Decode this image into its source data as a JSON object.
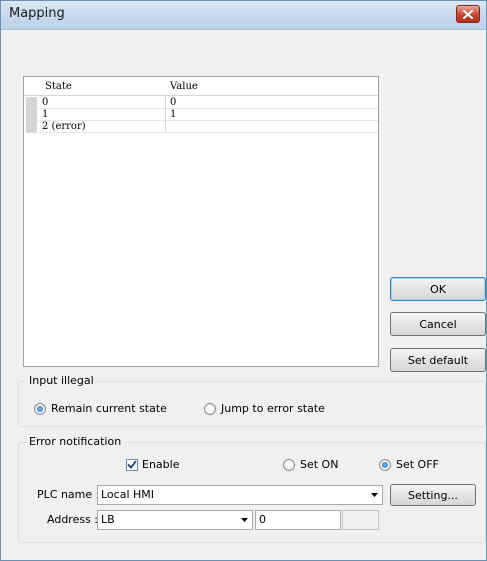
{
  "window": {
    "title": "Mapping"
  },
  "grid": {
    "columns": [
      "State",
      "Value"
    ],
    "rows": [
      {
        "state": "0",
        "value": "0"
      },
      {
        "state": "1",
        "value": "1"
      },
      {
        "state": "2 (error)",
        "value": ""
      }
    ]
  },
  "buttons": {
    "ok": "OK",
    "cancel": "Cancel",
    "set_default": "Set default",
    "setting": "Setting..."
  },
  "input_illegal": {
    "label": "Input illegal",
    "remain": "Remain current state",
    "jump": "Jump to error state",
    "selected": "remain"
  },
  "error_notification": {
    "label": "Error notification",
    "enable": "Enable",
    "enable_checked": true,
    "set_on": "Set ON",
    "set_off": "Set OFF",
    "selected": "set_off",
    "plc_name_label": "PLC name :",
    "plc_name": "Local HMI",
    "address_label": "Address :",
    "address_type": "LB",
    "address_value": "0"
  }
}
